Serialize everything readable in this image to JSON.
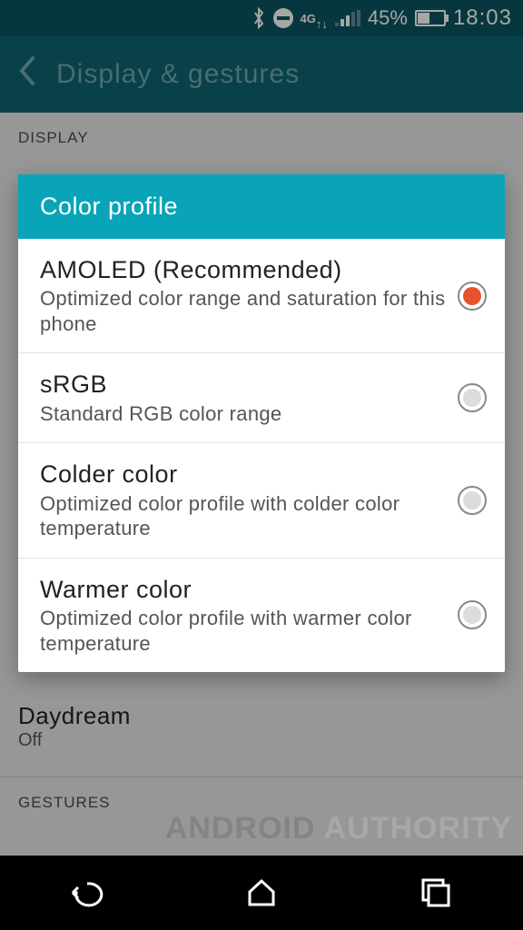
{
  "status_bar": {
    "battery_pct": "45%",
    "time": "18:03",
    "network": "4G"
  },
  "header": {
    "title": "Display & gestures"
  },
  "sections": {
    "display_label": "DISPLAY",
    "gestures_label": "GESTURES"
  },
  "bg_items": {
    "daydream": {
      "title": "Daydream",
      "sub": "Off"
    }
  },
  "dialog": {
    "title": "Color profile",
    "options": [
      {
        "title": "AMOLED (Recommended)",
        "desc": "Optimized color range and saturation for this phone",
        "selected": true
      },
      {
        "title": "sRGB",
        "desc": "Standard RGB color range",
        "selected": false
      },
      {
        "title": "Colder color",
        "desc": "Optimized color profile with colder color temperature",
        "selected": false
      },
      {
        "title": "Warmer color",
        "desc": "Optimized color profile with warmer color temperature",
        "selected": false
      }
    ]
  },
  "watermark": {
    "part1": "ANDROID ",
    "part2": "AUTHORITY"
  }
}
